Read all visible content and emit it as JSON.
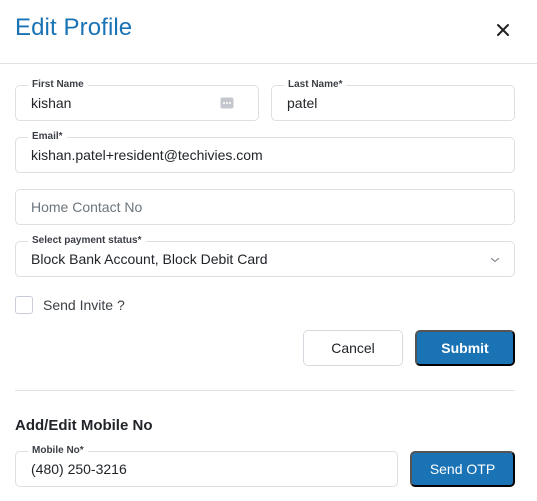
{
  "dialog": {
    "title": "Edit Profile",
    "close_icon": "close-icon"
  },
  "form": {
    "first_name": {
      "label": "First Name",
      "value": "kishan"
    },
    "last_name": {
      "label": "Last Name*",
      "value": "patel"
    },
    "email": {
      "label": "Email*",
      "value": "kishan.patel+resident@techivies.com"
    },
    "home_contact": {
      "placeholder": "Home Contact No"
    },
    "payment_status": {
      "label": "Select payment status*",
      "value": "Block Bank Account, Block Debit Card"
    },
    "send_invite": {
      "label": "Send Invite ?",
      "checked": false
    }
  },
  "actions": {
    "cancel_label": "Cancel",
    "submit_label": "Submit"
  },
  "mobile_section": {
    "title": "Add/Edit Mobile No",
    "mobile": {
      "label": "Mobile No*",
      "value": "(480) 250-3216"
    },
    "send_otp_label": "Send OTP"
  },
  "colors": {
    "accent": "#1a73b5",
    "border": "#dcdfe4"
  }
}
